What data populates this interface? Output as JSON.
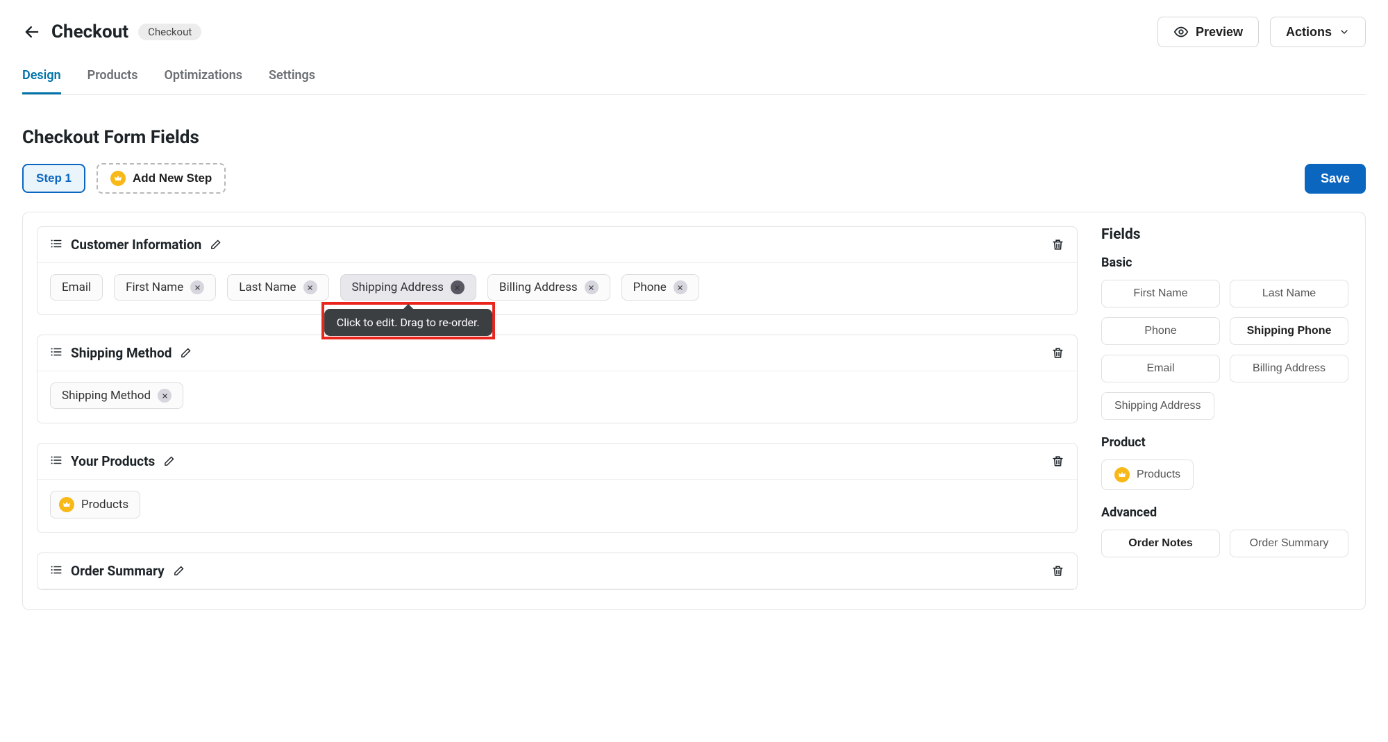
{
  "header": {
    "title": "Checkout",
    "badge": "Checkout",
    "preview_label": "Preview",
    "actions_label": "Actions"
  },
  "tabs": [
    {
      "label": "Design",
      "active": true
    },
    {
      "label": "Products",
      "active": false
    },
    {
      "label": "Optimizations",
      "active": false
    },
    {
      "label": "Settings",
      "active": false
    }
  ],
  "section_title": "Checkout Form Fields",
  "steps": {
    "active_step_label": "Step 1",
    "add_step_label": "Add New Step",
    "save_label": "Save"
  },
  "tooltip_text": "Click to edit. Drag to re-order.",
  "sections": [
    {
      "name": "Customer Information",
      "chips": [
        {
          "label": "Email",
          "closable": false
        },
        {
          "label": "First Name",
          "closable": true
        },
        {
          "label": "Last Name",
          "closable": true
        },
        {
          "label": "Shipping Address",
          "closable": true,
          "selected": true
        },
        {
          "label": "Billing Address",
          "closable": true
        },
        {
          "label": "Phone",
          "closable": true
        }
      ]
    },
    {
      "name": "Shipping Method",
      "chips": [
        {
          "label": "Shipping Method",
          "closable": true
        }
      ]
    },
    {
      "name": "Your Products",
      "chips": [
        {
          "label": "Products",
          "crown": true,
          "closable": false
        }
      ]
    },
    {
      "name": "Order Summary",
      "chips": []
    }
  ],
  "side_panel": {
    "title": "Fields",
    "groups": [
      {
        "heading": "Basic",
        "fields": [
          {
            "label": "First Name"
          },
          {
            "label": "Last Name"
          },
          {
            "label": "Phone"
          },
          {
            "label": "Shipping Phone",
            "bold": true
          },
          {
            "label": "Email"
          },
          {
            "label": "Billing Address"
          },
          {
            "label": "Shipping Address",
            "wide": true
          }
        ]
      },
      {
        "heading": "Product",
        "fields": [
          {
            "label": "Products",
            "crown": true,
            "wide": true
          }
        ]
      },
      {
        "heading": "Advanced",
        "fields": [
          {
            "label": "Order Notes",
            "bold": true
          },
          {
            "label": "Order Summary"
          }
        ]
      }
    ]
  }
}
